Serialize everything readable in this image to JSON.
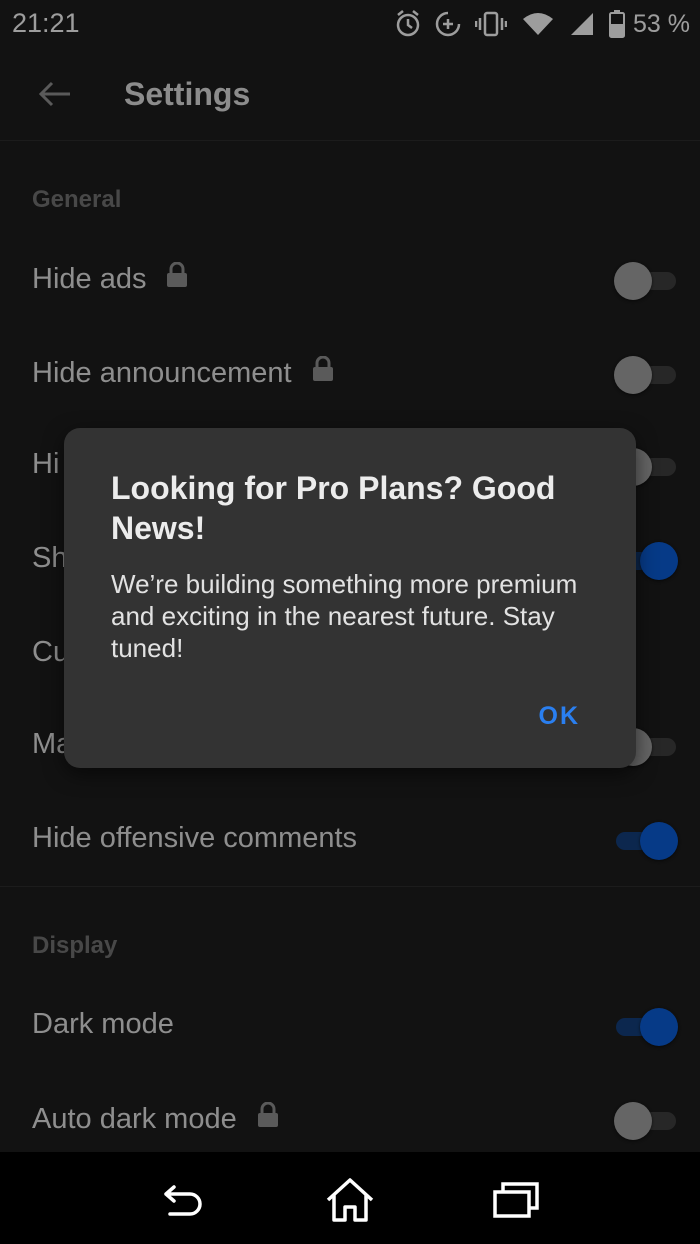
{
  "status_bar": {
    "time": "21:21",
    "battery_percent": "53 %",
    "icons": [
      "alarm-icon",
      "data-saver-icon",
      "vibrate-icon",
      "wifi-icon",
      "cell-signal-icon",
      "battery-icon"
    ]
  },
  "app_bar": {
    "back_icon": "arrow-left-icon",
    "title": "Settings"
  },
  "sections": {
    "general": {
      "header": "General"
    },
    "display": {
      "header": "Display"
    }
  },
  "settings": {
    "hide_ads": {
      "label": "Hide ads",
      "locked": true,
      "enabled": false
    },
    "hide_announcement": {
      "label": "Hide announcement",
      "locked": true,
      "enabled": false
    },
    "row3": {
      "label": "Hi",
      "enabled": false
    },
    "row4": {
      "label": "Sh",
      "enabled": true
    },
    "row5": {
      "label": "Cu"
    },
    "row6": {
      "label": "Ma",
      "enabled": false
    },
    "hide_offensive_comments": {
      "label": "Hide offensive comments",
      "enabled": true
    },
    "dark_mode": {
      "label": "Dark mode",
      "enabled": true
    },
    "auto_dark_mode": {
      "label": "Auto dark mode",
      "locked": true,
      "enabled": false
    }
  },
  "dialog": {
    "title": "Looking for Pro Plans? Good News!",
    "body": "We’re building something more premium and exciting in the nearest future. Stay tuned!",
    "ok_label": "OK"
  },
  "nav_bar": {
    "icons": [
      "back-nav-icon",
      "home-icon",
      "recents-icon"
    ]
  },
  "colors": {
    "background": "#1c1c1c",
    "dialog": "#333333",
    "accent": "#0a5ad0",
    "ok_text": "#2a7ff0"
  }
}
